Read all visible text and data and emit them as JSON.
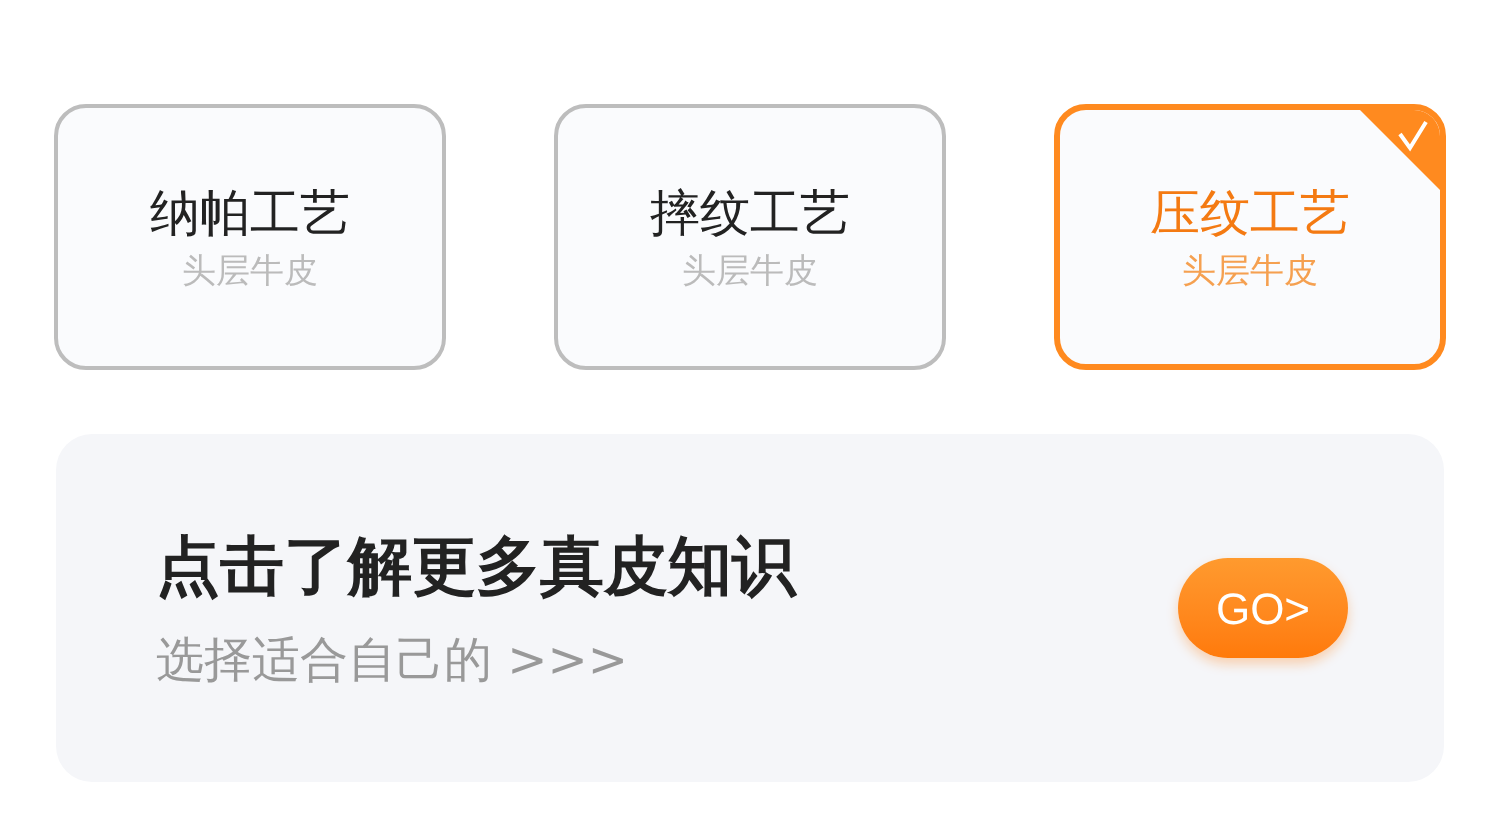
{
  "options": [
    {
      "title": "纳帕工艺",
      "subtitle": "头层牛皮",
      "selected": false
    },
    {
      "title": "摔纹工艺",
      "subtitle": "头层牛皮",
      "selected": false
    },
    {
      "title": "压纹工艺",
      "subtitle": "头层牛皮",
      "selected": true
    }
  ],
  "banner": {
    "title": "点击了解更多真皮知识",
    "subtitle": "选择适合自己的 >>>",
    "button": "GO>"
  }
}
